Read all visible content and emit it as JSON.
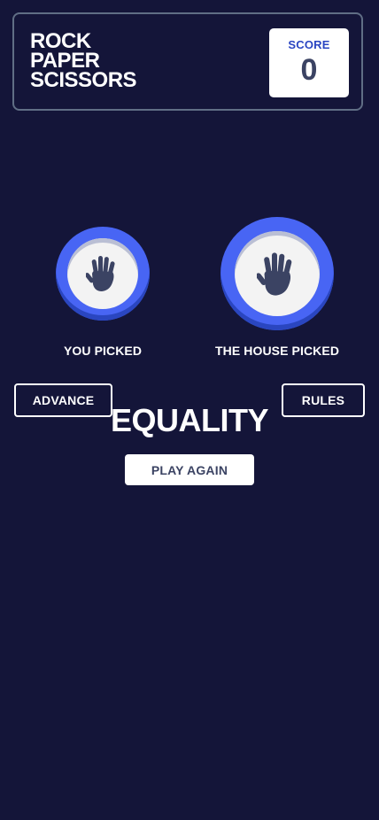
{
  "header": {
    "title_lines": [
      "ROCK",
      "PAPER",
      "SCISSORS"
    ],
    "score_label": "SCORE",
    "score_value": "0"
  },
  "game": {
    "player": {
      "label": "YOU PICKED",
      "choice_icon": "paper-hand-icon"
    },
    "house": {
      "label": "THE HOUSE PICKED",
      "choice_icon": "paper-hand-icon"
    },
    "result_text": "EQUALITY",
    "play_again_label": "PLAY AGAIN"
  },
  "controls": {
    "advance_label": "ADVANCE",
    "rules_label": "RULES"
  },
  "colors": {
    "background": "#141539",
    "header_border": "#606e85",
    "paper_token": "#4865f4",
    "score_label": "#2a45c2",
    "dark_text": "#3b4363"
  }
}
